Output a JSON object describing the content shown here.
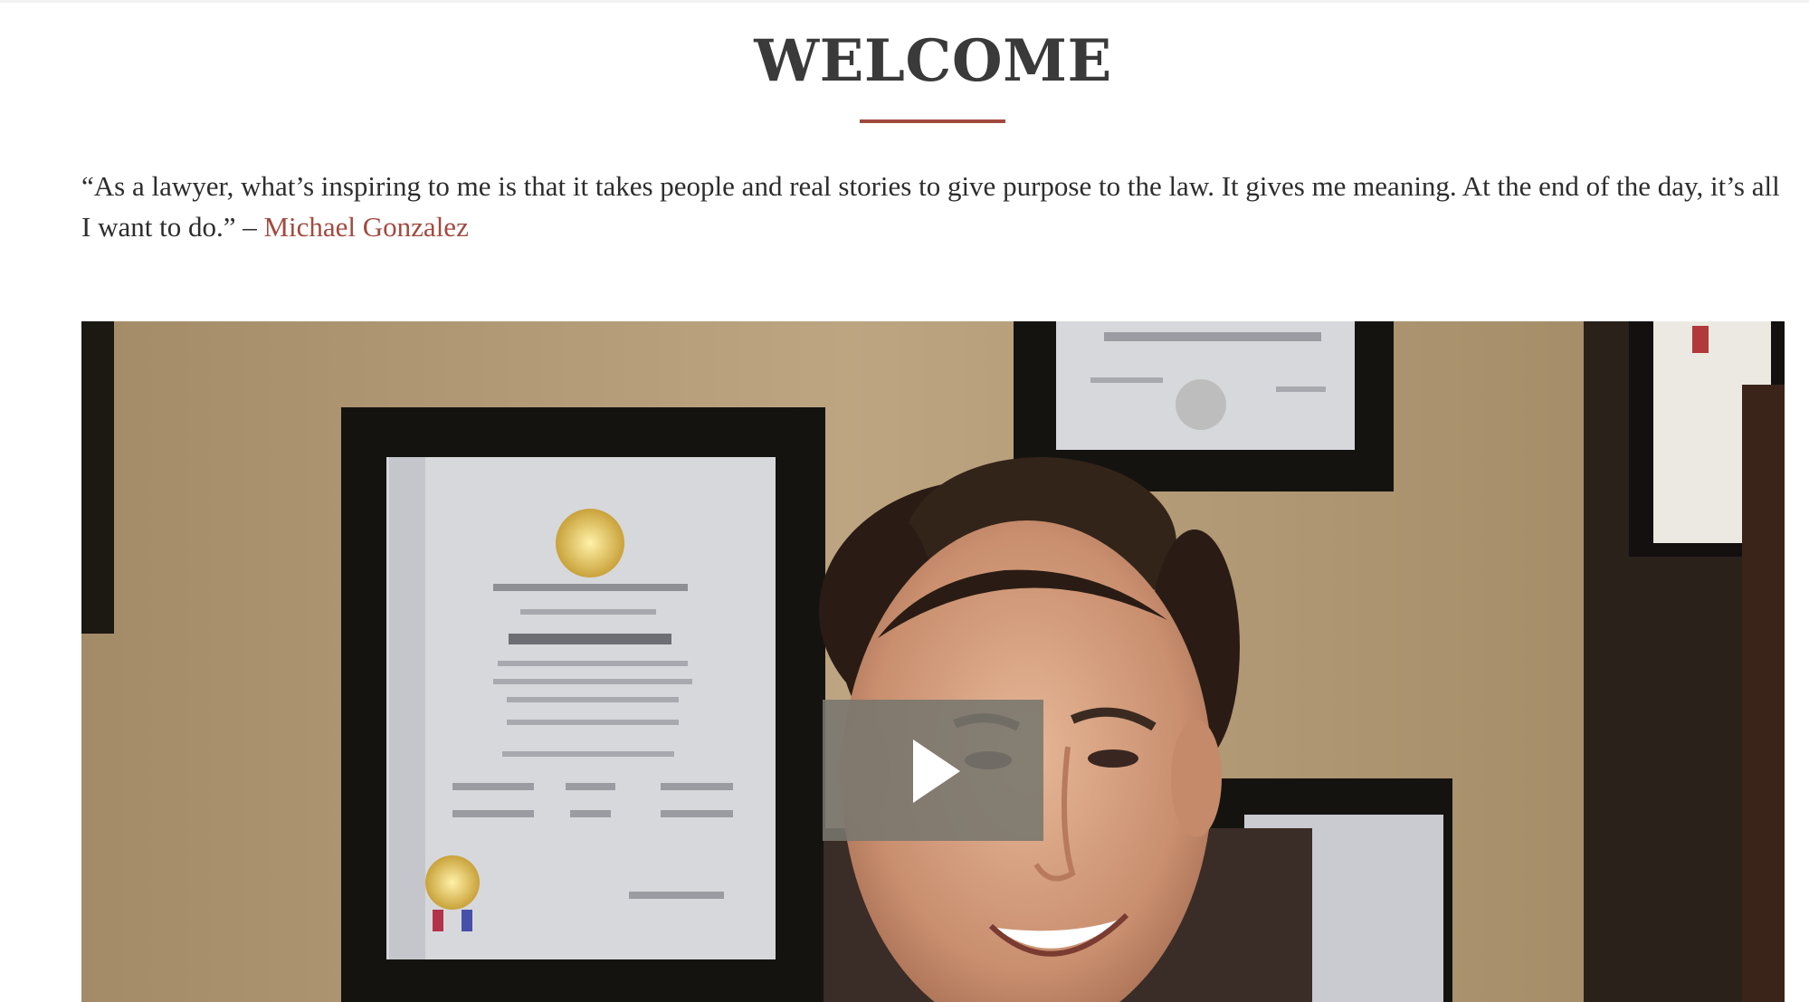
{
  "section": {
    "title": "WELCOME"
  },
  "quote": {
    "text": "“As a lawyer, what’s inspiring to me is that it takes people and real stories to give purpose to the law. It gives me meaning. At the end of the day, it’s all I want to do.” – ",
    "author": "Michael Gonzalez"
  },
  "video": {
    "play_icon": "play-icon",
    "accent_color": "#a04a3f"
  }
}
